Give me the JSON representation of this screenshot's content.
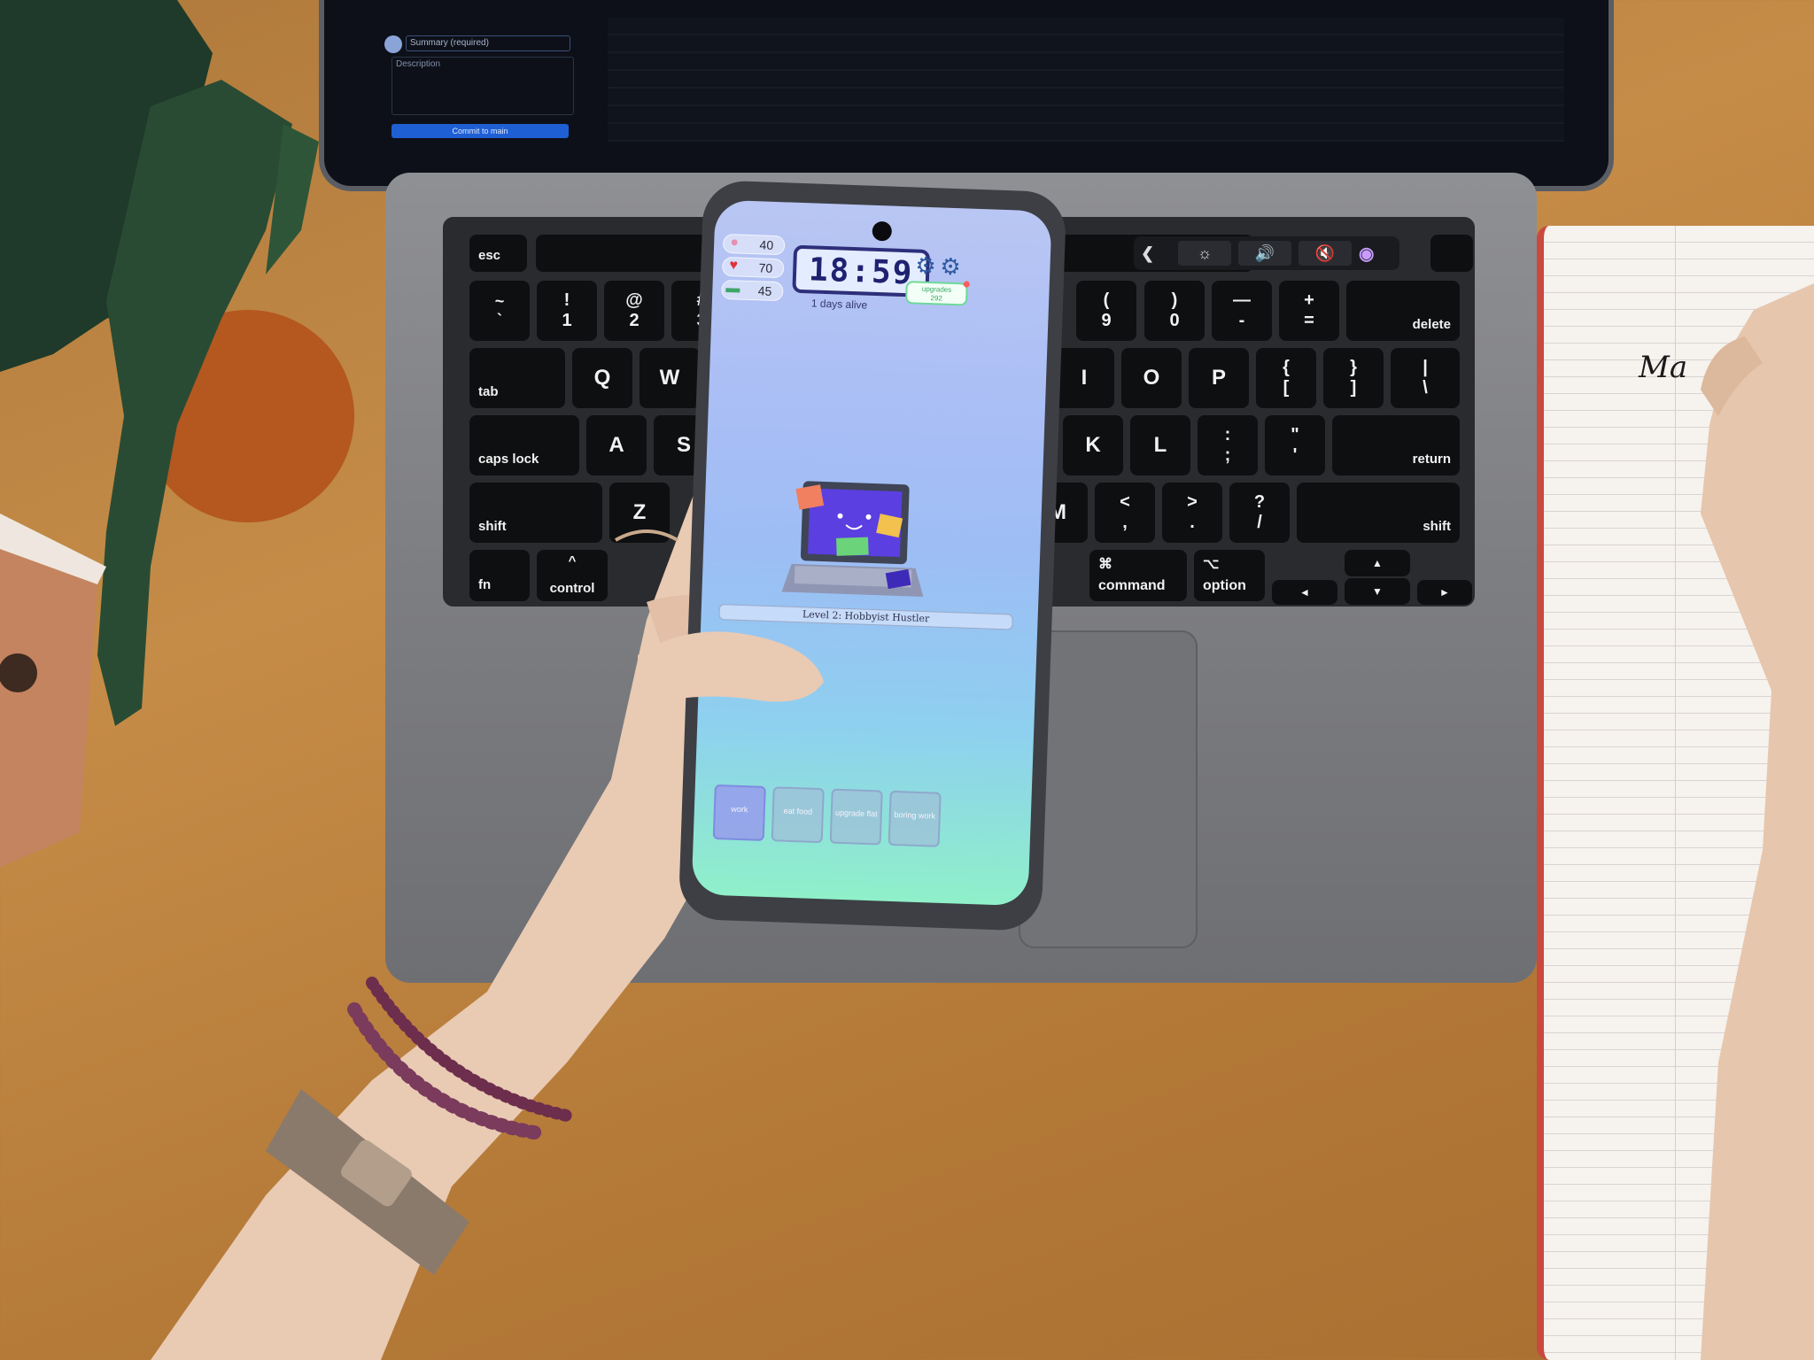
{
  "scene": {
    "colors": {
      "desk": "#b87c3c",
      "phone_accent": "#2d2f7a",
      "notebook_margin": "#c9493f"
    }
  },
  "keyboard": {
    "row_fn": [
      "esc"
    ],
    "row_num": [
      [
        "~",
        "`"
      ],
      [
        "!",
        "1"
      ],
      [
        "@",
        "2"
      ],
      [
        "#",
        "3"
      ],
      [
        "(",
        "9"
      ],
      [
        ")",
        "0"
      ],
      [
        "—",
        "-"
      ],
      [
        "+",
        "="
      ]
    ],
    "delete": "delete",
    "tab": "tab",
    "row_q": [
      "Q",
      "W"
    ],
    "row_q_right": [
      "I",
      "O",
      "P"
    ],
    "brackets": [
      [
        "{",
        "["
      ],
      [
        "}",
        "]"
      ],
      [
        "|",
        "\\"
      ]
    ],
    "caps_lock": "caps lock",
    "row_a": [
      "A",
      "S"
    ],
    "row_a_right": [
      "K",
      "L"
    ],
    "semicolon": [
      ":",
      ";"
    ],
    "quote": [
      "\"",
      "'"
    ],
    "return": "return",
    "shift_left": "shift",
    "row_z": [
      "Z"
    ],
    "m_key": "M",
    "comma": [
      "<",
      ","
    ],
    "period": [
      ">",
      "."
    ],
    "slash": [
      "?",
      "/"
    ],
    "shift_right": "shift",
    "fn": "fn",
    "control": "control",
    "control_symbol": "^",
    "command": "command",
    "command_symbol": "⌘",
    "option": "option",
    "option_symbol": "⌥",
    "arrow_up": "▲",
    "arrow_down": "▼",
    "arrow_left": "◄",
    "arrow_right": "►"
  },
  "touchbar": {
    "icons": [
      "chevron-left-icon",
      "brightness-icon",
      "volume-icon",
      "mute-icon",
      "siri-icon"
    ],
    "labels": [
      "❮",
      "☼",
      "🔊",
      "🔇",
      "◉"
    ]
  },
  "mac_screen": {
    "field_label": "Summary (required)",
    "description_label": "Description",
    "commit_button": "Commit to main"
  },
  "phone": {
    "stats": {
      "energy": "40",
      "health": "70",
      "money": "45"
    },
    "clock": "18:59",
    "days_alive": "1  days alive",
    "upgrades_label": "upgrades",
    "upgrades_value": "292",
    "level": "Level 2: Hobbyist Hustler",
    "actions": [
      {
        "label": "work"
      },
      {
        "label": "eat food"
      },
      {
        "label": "upgrade flat"
      },
      {
        "label": "boring work"
      }
    ]
  },
  "notebook": {
    "handwriting": "Ma"
  }
}
